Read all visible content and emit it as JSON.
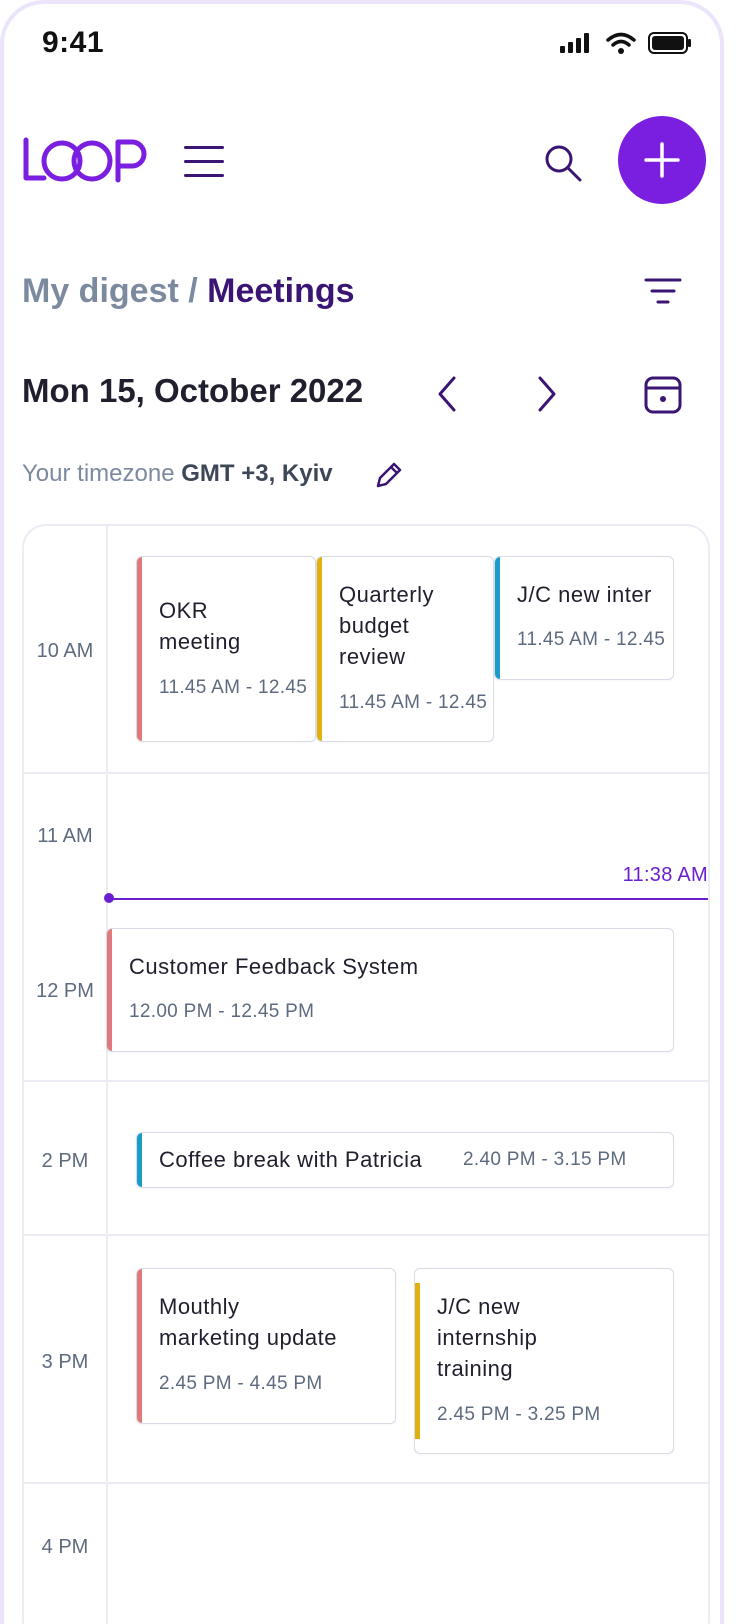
{
  "status_bar": {
    "time": "9:41"
  },
  "header": {
    "logo_text": "LOOP"
  },
  "breadcrumb": {
    "parent": "My digest",
    "separator": " / ",
    "current": "Meetings"
  },
  "date_nav": {
    "date": "Mon 15, October 2022"
  },
  "timezone": {
    "label": "Your timezone ",
    "value": "GMT +3, Kyiv"
  },
  "hours": [
    "10 AM",
    "11 AM",
    "12 PM",
    "2 PM",
    "3 PM",
    "4 PM"
  ],
  "now_indicator": {
    "label": "11:38 AM"
  },
  "events": [
    {
      "title": "OKR\nmeeting",
      "time": "11.45 AM - 12.45",
      "color": "#e07a7a"
    },
    {
      "title": "Quarterly\nbudget\nreview",
      "time": "11.45 AM - 12.45",
      "color": "#e0b00e"
    },
    {
      "title": "J/C new inter",
      "time": "11.45 AM - 12.45",
      "color": "#1b9cc8"
    },
    {
      "title": "Customer Feedback System",
      "time": "12.00 PM - 12.45 PM",
      "color": "#e07a7a"
    },
    {
      "title": "Coffee break with Patricia",
      "time": "2.40 PM - 3.15 PM",
      "color": "#1b9cc8"
    },
    {
      "title": "Mouthly\nmarketing update",
      "time": "2.45 PM - 4.45 PM",
      "color": "#e07a7a"
    },
    {
      "title": "J/C new\ninternship\ntraining",
      "time": "2.45 PM - 3.25 PM",
      "color": "#e0b00e"
    }
  ],
  "colors": {
    "brand": "#7a1fe0",
    "dark_brand": "#3b1573",
    "muted": "#7c8aa0"
  },
  "icons": [
    "signal-icon",
    "wifi-icon",
    "battery-icon",
    "menu-icon",
    "search-icon",
    "plus-icon",
    "filter-icon",
    "chevron-left-icon",
    "chevron-right-icon",
    "calendar-icon",
    "pencil-icon"
  ]
}
